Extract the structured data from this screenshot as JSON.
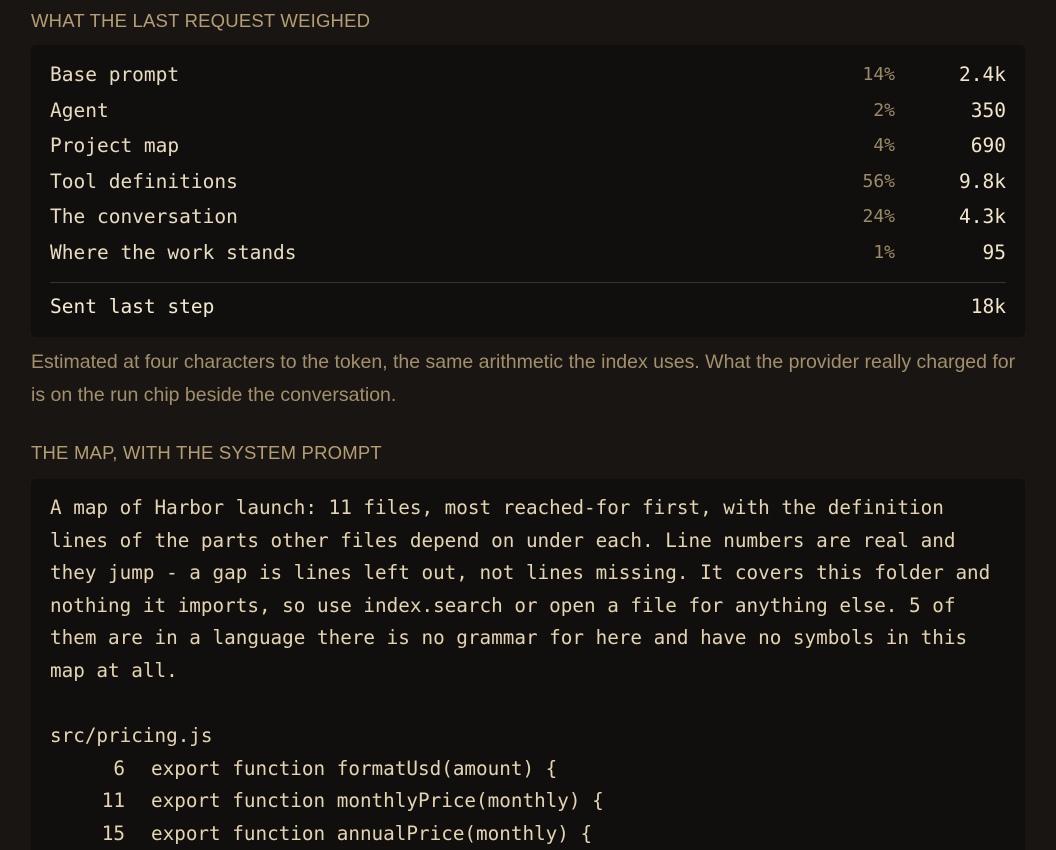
{
  "weigh": {
    "title": "WHAT THE LAST REQUEST WEIGHED",
    "rows": [
      {
        "label": "Base prompt",
        "pct": "14%",
        "value": "2.4k"
      },
      {
        "label": "Agent",
        "pct": "2%",
        "value": "350"
      },
      {
        "label": "Project map",
        "pct": "4%",
        "value": "690"
      },
      {
        "label": "Tool definitions",
        "pct": "56%",
        "value": "9.8k"
      },
      {
        "label": "The conversation",
        "pct": "24%",
        "value": "4.3k"
      },
      {
        "label": "Where the work stands",
        "pct": "1%",
        "value": "95"
      }
    ],
    "total_label": "Sent last step",
    "total_value": "18k",
    "note": "Estimated at four characters to the token, the same arithmetic the index uses. What the provider really charged for is on the run chip beside the conversation."
  },
  "map": {
    "title": "THE MAP, WITH THE SYSTEM PROMPT",
    "intro": "A map of Harbor launch: 11 files, most reached-for first, with the definition lines of the parts other files depend on under each. Line numbers are real and they jump - a gap is lines left out, not lines missing. It covers this folder and nothing it imports, so use index.search or open a file for anything else. 5 of them are in a language there is no grammar for here and have no symbols in this map at all.",
    "file": "src/pricing.js",
    "symbols": [
      {
        "line": "6",
        "code": "export function formatUsd(amount) {"
      },
      {
        "line": "11",
        "code": "export function monthlyPrice(monthly) {"
      },
      {
        "line": "15",
        "code": "export function annualPrice(monthly) {"
      }
    ]
  },
  "colors": {
    "background": "#181513",
    "panel": "#110f0d",
    "heading": "#b59e72",
    "text": "#e3d4b2",
    "muted": "#9a8a68"
  }
}
